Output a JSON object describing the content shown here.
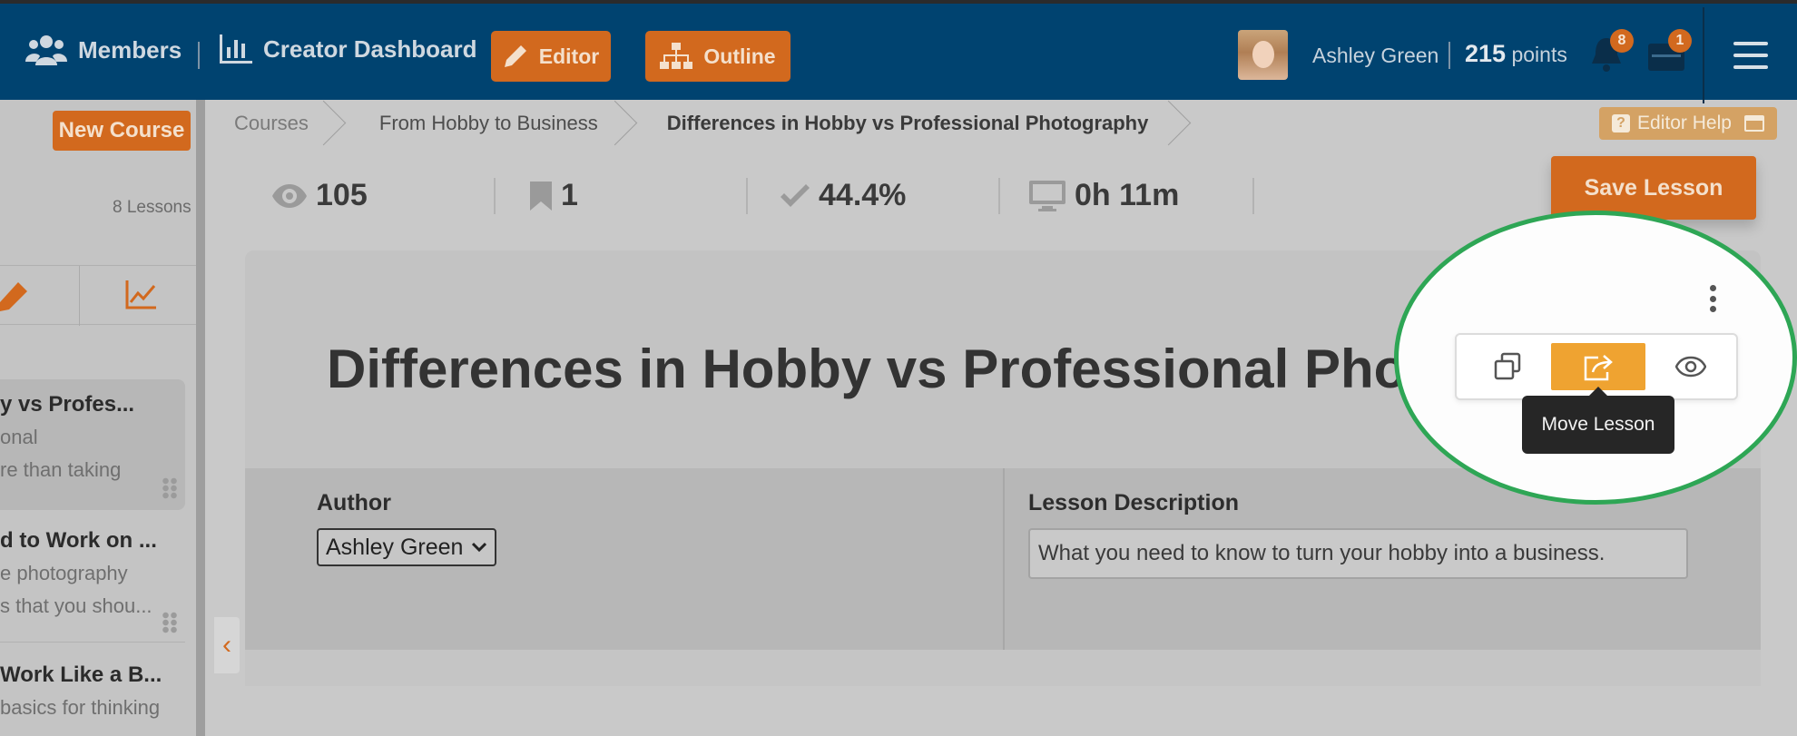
{
  "header": {
    "members_label": "Members",
    "creator_dashboard_label": "Creator Dashboard",
    "editor_label": "Editor",
    "outline_label": "Outline",
    "user_name": "Ashley Green",
    "points_value": "215",
    "points_label": "points",
    "notifications_count": "8",
    "inbox_count": "1"
  },
  "sidebar": {
    "new_course_label": "New Course",
    "lessons_count": "8 Lessons",
    "lessons": [
      {
        "title": "y vs Profes...",
        "line1": "onal",
        "line2": "re than taking"
      },
      {
        "title": "d to Work on ...",
        "line1": "e photography",
        "line2": "s that you shou..."
      },
      {
        "title": "Work Like a B...",
        "line1": "basics for thinking"
      }
    ]
  },
  "breadcrumb": {
    "items": [
      "Courses",
      "From Hobby to Business",
      "Differences in Hobby vs Professional Photography"
    ]
  },
  "editor_help_label": "Editor Help",
  "stats": {
    "views": "105",
    "bookmarks": "1",
    "completion": "44.4%",
    "duration": "0h 11m"
  },
  "save_lesson_label": "Save Lesson",
  "lesson": {
    "title": "Differences in Hobby vs Professional Photogra",
    "author_label": "Author",
    "author_value": "Ashley Green",
    "description_label": "Lesson Description",
    "description_value": "What you need to know to turn your hobby into a business."
  },
  "actions": {
    "tooltip": "Move Lesson"
  },
  "colors": {
    "topbar": "#004370",
    "accent_orange": "#d2691e",
    "highlight_orange": "#efa331",
    "highlight_ring": "#2ea655"
  }
}
